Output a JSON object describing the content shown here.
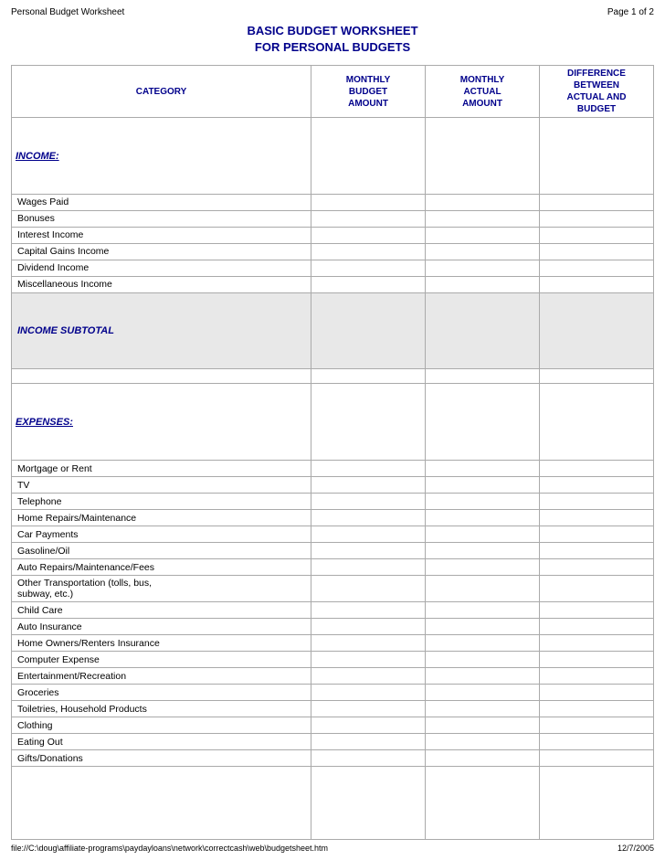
{
  "header": {
    "doc_title": "Personal Budget Worksheet",
    "page_info": "Page 1 of 2"
  },
  "title": {
    "line1": "BASIC BUDGET WORKSHEET",
    "line2": "FOR PERSONAL BUDGETS"
  },
  "table": {
    "columns": {
      "category": "CATEGORY",
      "budget": "MONTHLY\nBUDGET\nAMOUNT",
      "actual": "MONTHLY\nACTUAL\nAMOUNT",
      "diff": "DIFFERENCE\nBETWEEN\nACTUAL AND\nBUDGET"
    },
    "sections": [
      {
        "type": "section-header",
        "label": "INCOME:"
      },
      {
        "type": "data-row",
        "label": "Wages Paid"
      },
      {
        "type": "data-row",
        "label": "Bonuses"
      },
      {
        "type": "data-row",
        "label": "Interest Income"
      },
      {
        "type": "data-row",
        "label": "Capital Gains Income"
      },
      {
        "type": "data-row",
        "label": "Dividend Income"
      },
      {
        "type": "data-row",
        "label": "Miscellaneous Income"
      },
      {
        "type": "subtotal-row",
        "label": "INCOME SUBTOTAL"
      },
      {
        "type": "blank-row"
      },
      {
        "type": "section-header",
        "label": "EXPENSES:"
      },
      {
        "type": "data-row",
        "label": "Mortgage or Rent"
      },
      {
        "type": "data-row",
        "label": "TV"
      },
      {
        "type": "data-row",
        "label": "Telephone"
      },
      {
        "type": "data-row",
        "label": "Home Repairs/Maintenance"
      },
      {
        "type": "data-row",
        "label": "Car Payments"
      },
      {
        "type": "data-row",
        "label": "Gasoline/Oil"
      },
      {
        "type": "data-row",
        "label": "Auto Repairs/Maintenance/Fees"
      },
      {
        "type": "tall-row",
        "label": "Other Transportation (tolls, bus,\nsubway, etc.)"
      },
      {
        "type": "data-row",
        "label": "Child Care"
      },
      {
        "type": "data-row",
        "label": "Auto Insurance"
      },
      {
        "type": "data-row",
        "label": "Home Owners/Renters Insurance"
      },
      {
        "type": "data-row",
        "label": "Computer Expense"
      },
      {
        "type": "data-row",
        "label": "Entertainment/Recreation"
      },
      {
        "type": "data-row",
        "label": "Groceries"
      },
      {
        "type": "data-row",
        "label": "Toiletries, Household Products"
      },
      {
        "type": "data-row",
        "label": "Clothing"
      },
      {
        "type": "data-row",
        "label": "Eating Out"
      },
      {
        "type": "data-row",
        "label": "Gifts/Donations"
      },
      {
        "type": "empty-section"
      }
    ]
  },
  "footer": {
    "path": "file://C:\\doug\\affiliate-programs\\paydayloans\\network\\correctcash\\web\\budgetsheet.htm",
    "date": "12/7/2005"
  }
}
